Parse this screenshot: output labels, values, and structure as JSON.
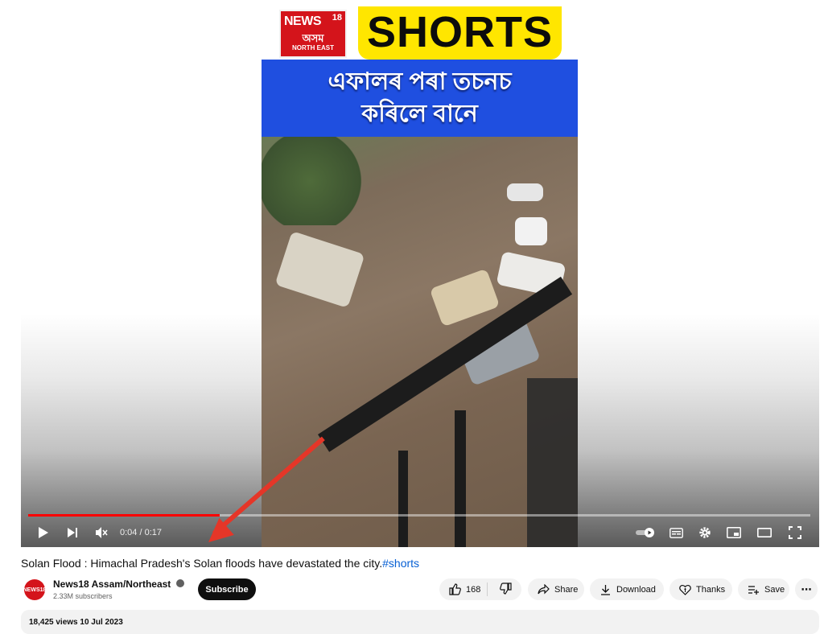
{
  "video": {
    "logo": {
      "brand": "NEWS",
      "number": "18",
      "region": "অসম",
      "subregion": "NORTH EAST"
    },
    "badge": "SHORTS",
    "headline": [
      "এফালৰ পৰা তচনচ",
      "কৰিলে বানে"
    ],
    "colors": {
      "badge": "#ffe600",
      "headline_band": "#1f4fe0",
      "logo": "#d4141b",
      "annotation_arrow": "#e53628"
    }
  },
  "player": {
    "progress": 0.245,
    "time": "0:04 / 0:17",
    "progress_color": "#ff0000",
    "left_controls": [
      "play-icon",
      "next-icon",
      "mute-icon"
    ],
    "right_controls": [
      "autoplay-toggle-icon",
      "subtitles-icon",
      "settings-icon",
      "miniplayer-icon",
      "theater-icon",
      "fullscreen-icon"
    ]
  },
  "title": {
    "text": "Solan Flood : Himachal Pradesh's Solan floods have devastated the city.",
    "hashtag": "#shorts"
  },
  "channel": {
    "avatar_text": "NEWS18",
    "name": "News18 Assam/Northeast",
    "subscribers": "2.33M subscribers",
    "subscribe_label": "Subscribe"
  },
  "actions": {
    "likes": "168",
    "share": "Share",
    "download": "Download",
    "thanks": "Thanks",
    "save": "Save",
    "more": "⋯"
  },
  "description": {
    "meta": "18,425 views 10 Jul 2023"
  }
}
